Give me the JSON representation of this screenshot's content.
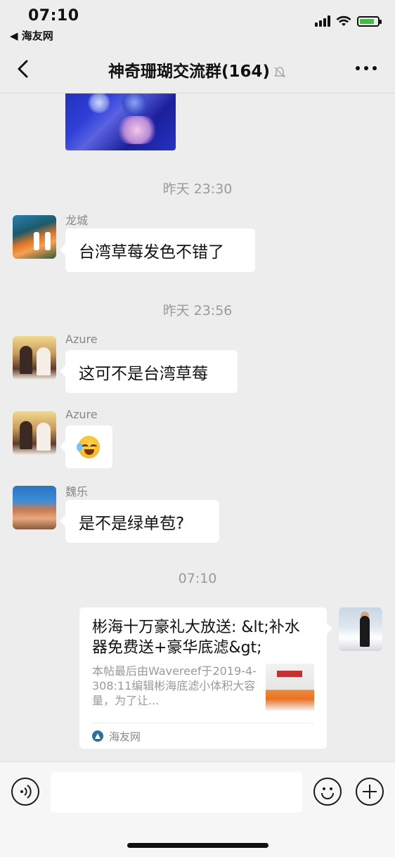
{
  "status_bar": {
    "time": "07:10",
    "back_app": "◀ 海友网",
    "battery_level": 0.85,
    "battery_color": "#3cc13c"
  },
  "nav": {
    "title": "神奇珊瑚交流群(164)",
    "back_icon": "chevron-left-icon",
    "mute_icon": "bell-off-icon",
    "more_icon": "more-icon"
  },
  "messages": [
    {
      "type": "image",
      "sender": "",
      "description_icon": "coral-photo"
    },
    {
      "type": "timestamp",
      "text": "昨天 23:30"
    },
    {
      "type": "text",
      "sender": "龙城",
      "text": "台湾草莓发色不错了"
    },
    {
      "type": "timestamp",
      "text": "昨天 23:56"
    },
    {
      "type": "text",
      "sender": "Azure",
      "text": "这可不是台湾草莓"
    },
    {
      "type": "emoji",
      "sender": "Azure",
      "icon": "crying-laughing-emoji"
    },
    {
      "type": "text",
      "sender": "魏乐",
      "text": "是不是绿单苞?"
    },
    {
      "type": "timestamp",
      "text": "07:10"
    },
    {
      "type": "link_card",
      "sender": "self",
      "title": "彬海十万豪礼大放送: &lt;补水器免费送+豪华底滤&gt;",
      "desc": "本帖最后由Wavereef于2019-4-308:11编辑彬海底滤小体积大容量，为了让...",
      "source": "海友网"
    }
  ],
  "input_bar": {
    "placeholder": "",
    "voice_icon": "voice-icon",
    "emoji_icon": "emoji-icon",
    "plus_icon": "plus-icon"
  }
}
